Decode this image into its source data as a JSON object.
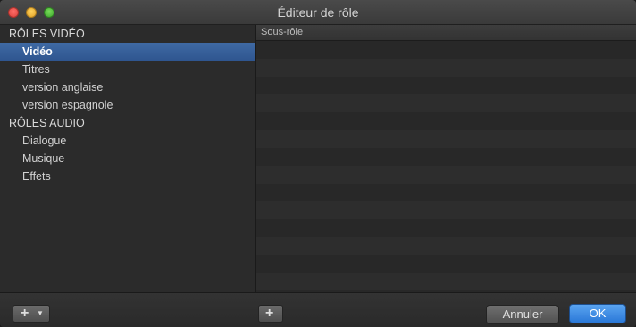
{
  "window": {
    "title": "Éditeur de rôle"
  },
  "sidebar": {
    "video_group": {
      "header": "RÔLES VIDÉO",
      "items": [
        {
          "label": "Vidéo",
          "selected": true
        },
        {
          "label": "Titres"
        },
        {
          "label": "version anglaise"
        },
        {
          "label": "version espagnole"
        }
      ]
    },
    "audio_group": {
      "header": "RÔLES AUDIO",
      "items": [
        {
          "label": "Dialogue"
        },
        {
          "label": "Musique"
        },
        {
          "label": "Effets"
        }
      ]
    }
  },
  "table": {
    "column_header": "Sous-rôle",
    "rows": []
  },
  "footer": {
    "add_role_icon": "plus-icon",
    "add_subrole_icon": "plus-icon",
    "cancel_label": "Annuler",
    "ok_label": "OK"
  },
  "colors": {
    "selection": "#2f5690",
    "ok_button": "#2a78d8"
  }
}
